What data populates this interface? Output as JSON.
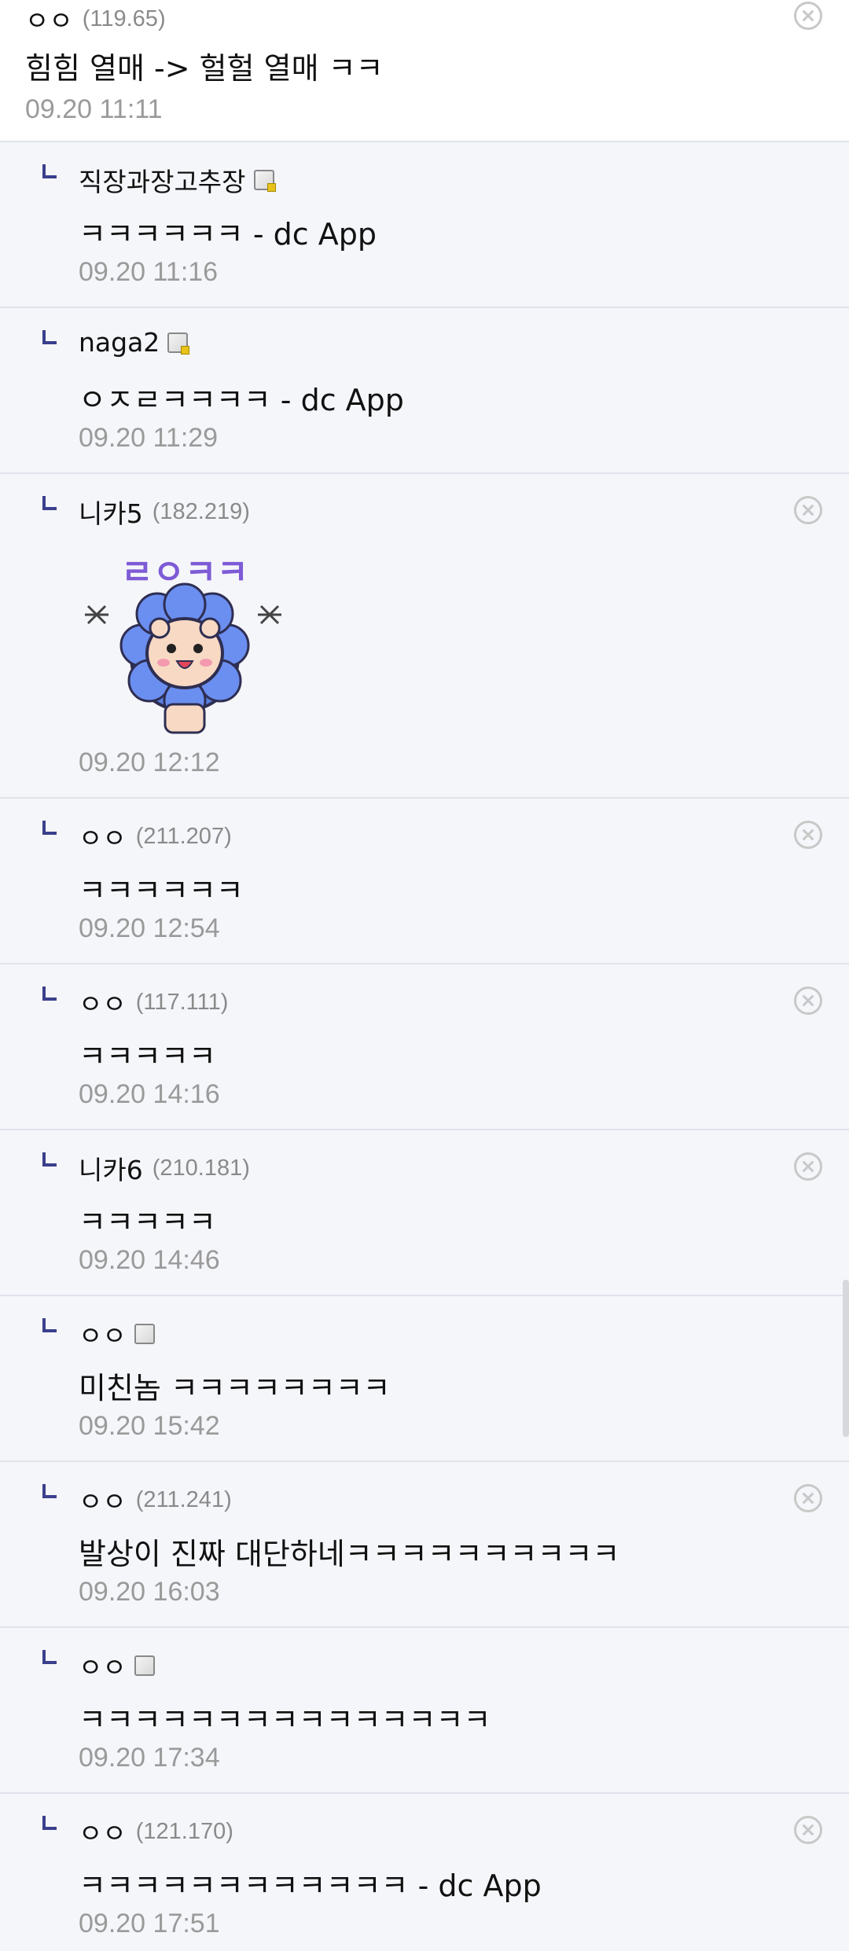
{
  "top_comment": {
    "nick": "ㅇㅇ",
    "ip": "(119.65)",
    "content": "힘힘 열매 -> 헐헐 열매 ㅋㅋ",
    "time": "09.20 11:11"
  },
  "replies": [
    {
      "nick": "직장과장고추장",
      "ip": "",
      "content": "ㅋㅋㅋㅋㅋㅋ - dc App",
      "time": "09.20 11:16"
    },
    {
      "nick": "naga2",
      "ip": "",
      "content": "ㅇㅈㄹㅋㅋㅋㅋ - dc App",
      "time": "09.20 11:29"
    },
    {
      "nick": "니카5",
      "ip": "(182.219)",
      "content": "",
      "sticker_text": "ㄹㅇㅋㅋ",
      "time": "09.20 12:12"
    },
    {
      "nick": "ㅇㅇ",
      "ip": "(211.207)",
      "content": "ㅋㅋㅋㅋㅋㅋ",
      "time": "09.20 12:54"
    },
    {
      "nick": "ㅇㅇ",
      "ip": "(117.111)",
      "content": "ㅋㅋㅋㅋㅋ",
      "time": "09.20 14:16"
    },
    {
      "nick": "니카6",
      "ip": "(210.181)",
      "content": "ㅋㅋㅋㅋㅋ",
      "time": "09.20 14:46"
    },
    {
      "nick": "ㅇㅇ",
      "ip": "",
      "content": "미친놈 ㅋㅋㅋㅋㅋㅋㅋㅋ",
      "time": "09.20 15:42"
    },
    {
      "nick": "ㅇㅇ",
      "ip": "(211.241)",
      "content": "발상이 진짜 대단하네ㅋㅋㅋㅋㅋㅋㅋㅋㅋㅋ",
      "time": "09.20 16:03"
    },
    {
      "nick": "ㅇㅇ",
      "ip": "",
      "content": "ㅋㅋㅋㅋㅋㅋㅋㅋㅋㅋㅋㅋㅋㅋㅋ",
      "time": "09.20 17:34"
    },
    {
      "nick": "ㅇㅇ",
      "ip": "(121.170)",
      "content": "ㅋㅋㅋㅋㅋㅋㅋㅋㅋㅋㅋㅋ - dc App",
      "time": "09.20 17:51"
    }
  ],
  "colors": {
    "reply_bg": "#f5f6fa",
    "reply_marker": "#3b3f8c",
    "divider": "#dfe3ea",
    "time_text": "#9a9a9a"
  },
  "icons": {
    "delete": "close-circle-icon",
    "member_badge": "gallery-member-icon",
    "reply_marker": "reply-arrow-icon"
  }
}
